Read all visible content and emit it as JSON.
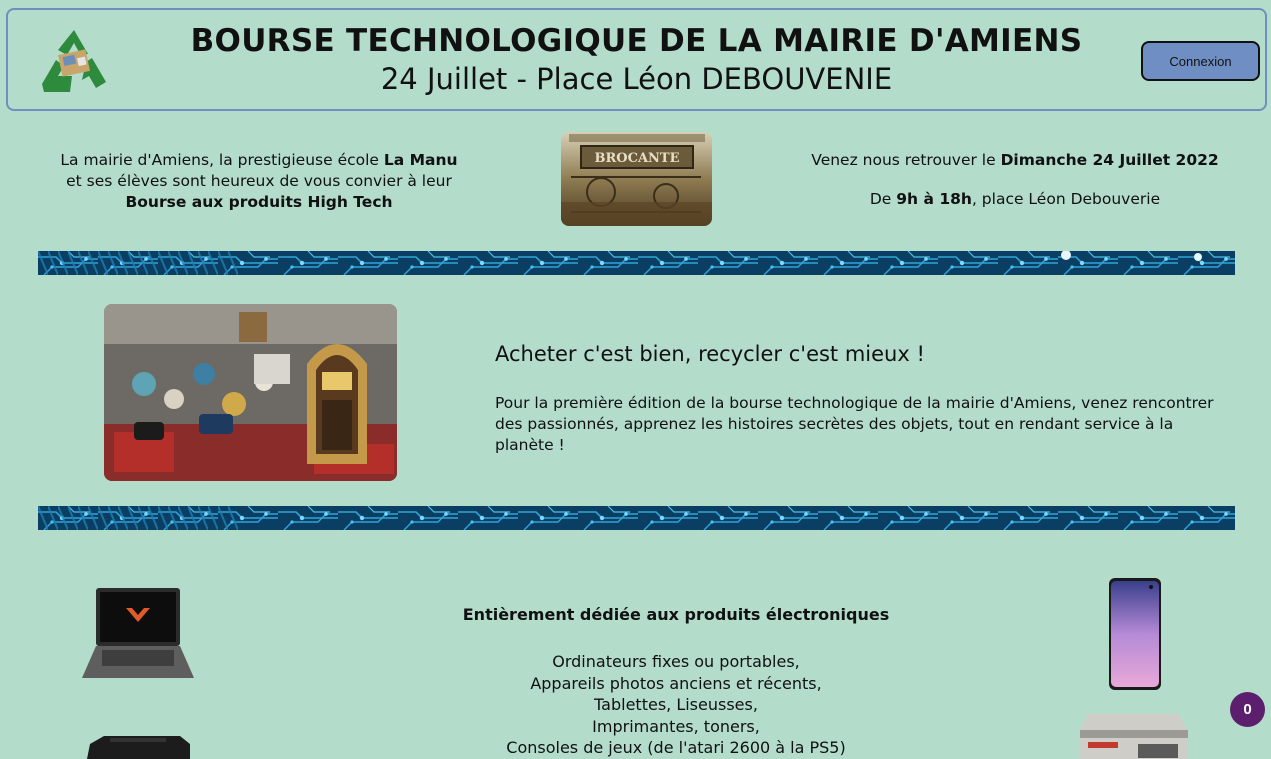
{
  "header": {
    "title": "BOURSE TECHNOLOGIQUE DE LA MAIRIE D'AMIENS",
    "subtitle": "24 Juillet - Place Léon DEBOUVENIE",
    "login_label": "Connexion",
    "logo_icon": "recycle-icon"
  },
  "intro_left": {
    "line1_a": "La mairie d'Amiens, la prestigieuse école ",
    "line1_b": "La Manu",
    "line2": "et ses élèves sont heureux de vous convier à leur",
    "line3": "Bourse aux produits High Tech"
  },
  "brocante_image": {
    "sign_text": "BROCANTE"
  },
  "intro_right": {
    "p1_a": "Venez nous retrouver le ",
    "p1_b": "Dimanche 24 Juillet 2022",
    "p2_a": "De ",
    "p2_b": "9h à 18h",
    "p2_c": ", place Léon Debouverie"
  },
  "middle": {
    "heading": "Acheter c'est bien, recycler c'est mieux !",
    "text": "Pour la première édition de la bourse technologique de la mairie d'Amiens, venez rencontrer des passionnés, apprenez les histoires secrètes des objets, tout en rendant service à la planète !"
  },
  "bottom": {
    "heading": "Entièrement dédiée aux produits électroniques",
    "items": [
      "Ordinateurs fixes ou portables,",
      "Appareils photos anciens et récents,",
      "Tablettes, Liseusses,",
      "Imprimantes, toners,",
      "Consoles de jeux (de l'atari 2600 à la PS5)"
    ]
  },
  "badge": {
    "count": "0"
  },
  "colors": {
    "background": "#b3dccb",
    "header_border": "#6f8fbf",
    "login_button": "#6f8fc4",
    "circuit_base": "#0b3e63",
    "circuit_trace": "#2ea4d8",
    "badge": "#5b1f6e"
  }
}
